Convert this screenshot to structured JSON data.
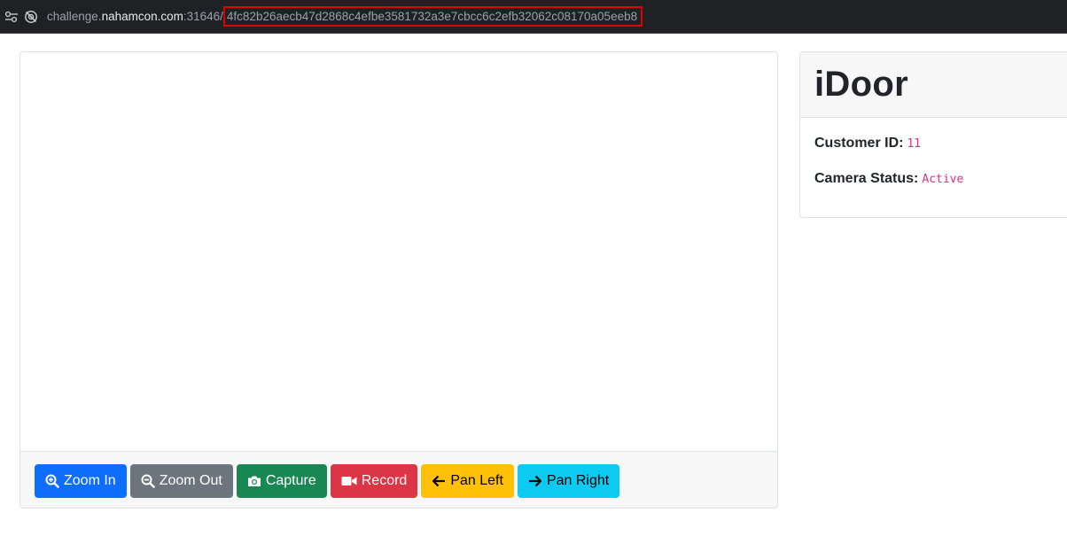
{
  "address_bar": {
    "scheme_prefix": "challenge.",
    "host": "nahamcon.com",
    "port": ":31646/",
    "path_hash": "4fc82b26aecb47d2868c4efbe3581732a3e7cbcc6c2efb32062c08170a05eeb8",
    "icons": [
      "site-settings-icon",
      "tracking-off-icon"
    ]
  },
  "camera": {
    "buttons": [
      {
        "label": "Zoom In",
        "icon": "zoom-in-icon",
        "color": "#0d6efd"
      },
      {
        "label": "Zoom Out",
        "icon": "zoom-out-icon",
        "color": "#6c757d"
      },
      {
        "label": "Capture",
        "icon": "camera-icon",
        "color": "#198754"
      },
      {
        "label": "Record",
        "icon": "video-icon",
        "color": "#dc3545"
      },
      {
        "label": "Pan Left",
        "icon": "arrow-left-icon",
        "color": "#ffc107"
      },
      {
        "label": "Pan Right",
        "icon": "arrow-right-icon",
        "color": "#0dcaf0"
      }
    ]
  },
  "info": {
    "title": "iDoor",
    "customer_id_label": "Customer ID:",
    "customer_id_value": "11",
    "camera_status_label": "Camera Status:",
    "camera_status_value": "Active"
  },
  "colors": {
    "highlight_box": "#e00000",
    "code_text": "#d63384"
  }
}
